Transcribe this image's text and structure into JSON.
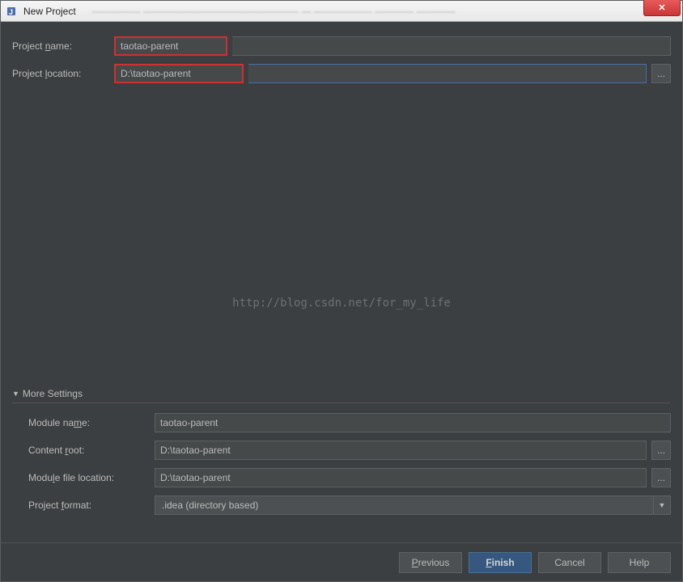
{
  "window": {
    "title": "New Project",
    "blurred_subtitle": "————— ———————————————— — —————— ———— ————"
  },
  "form": {
    "project_name_label": "Project name:",
    "project_name_value": "taotao-parent",
    "project_location_label": "Project location:",
    "project_location_value": "D:\\taotao-parent",
    "browse_label": "..."
  },
  "watermark": "http://blog.csdn.net/for_my_life",
  "more_settings": {
    "header": "More Settings",
    "module_name_label": "Module name:",
    "module_name_value": "taotao-parent",
    "content_root_label": "Content root:",
    "content_root_value": "D:\\taotao-parent",
    "module_file_location_label": "Module file location:",
    "module_file_location_value": "D:\\taotao-parent",
    "project_format_label": "Project format:",
    "project_format_value": ".idea (directory based)",
    "browse_label": "..."
  },
  "buttons": {
    "previous": "Previous",
    "finish": "Finish",
    "cancel": "Cancel",
    "help": "Help"
  }
}
